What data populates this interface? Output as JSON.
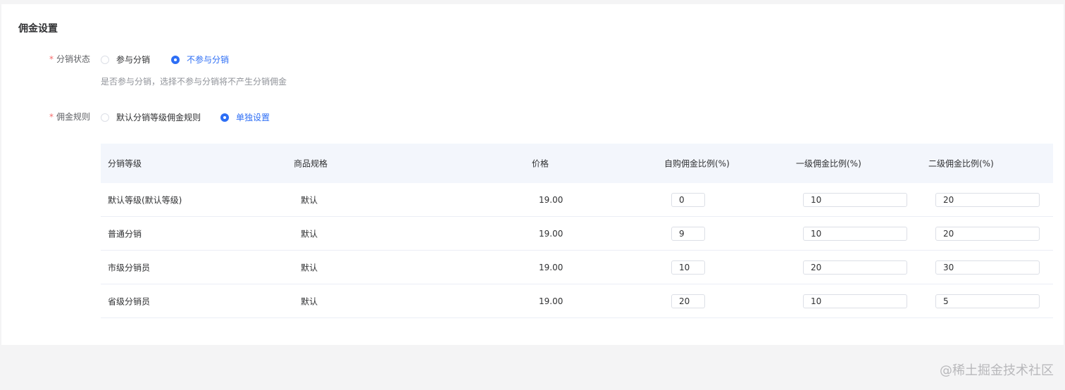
{
  "section": {
    "title": "佣金设置"
  },
  "distribution_status": {
    "required_mark": "*",
    "label": "分销状态",
    "options": [
      {
        "label": "参与分销",
        "checked": false
      },
      {
        "label": "不参与分销",
        "checked": true
      }
    ],
    "hint": "是否参与分销，选择不参与分销将不产生分销佣金"
  },
  "commission_rule": {
    "required_mark": "*",
    "label": "佣金规则",
    "options": [
      {
        "label": "默认分销等级佣金规则",
        "checked": false
      },
      {
        "label": "单独设置",
        "checked": true
      }
    ]
  },
  "table": {
    "headers": [
      "分销等级",
      "商品规格",
      "价格",
      "自购佣金比例(%)",
      "一级佣金比例(%)",
      "二级佣金比例(%)"
    ],
    "rows": [
      {
        "level": "默认等级(默认等级)",
        "spec": "默认",
        "price": "19.00",
        "self": "0",
        "first": "10",
        "second": "20"
      },
      {
        "level": "普通分销",
        "spec": "默认",
        "price": "19.00",
        "self": "9",
        "first": "10",
        "second": "20"
      },
      {
        "level": "市级分销员",
        "spec": "默认",
        "price": "19.00",
        "self": "10",
        "first": "20",
        "second": "30"
      },
      {
        "level": "省级分销员",
        "spec": "默认",
        "price": "19.00",
        "self": "20",
        "first": "10",
        "second": "5"
      }
    ]
  },
  "watermark": "@稀土掘金技术社区",
  "colors": {
    "accent": "#2d6ef5",
    "required": "#f56c6c",
    "header_bg": "#f3f6fc"
  }
}
